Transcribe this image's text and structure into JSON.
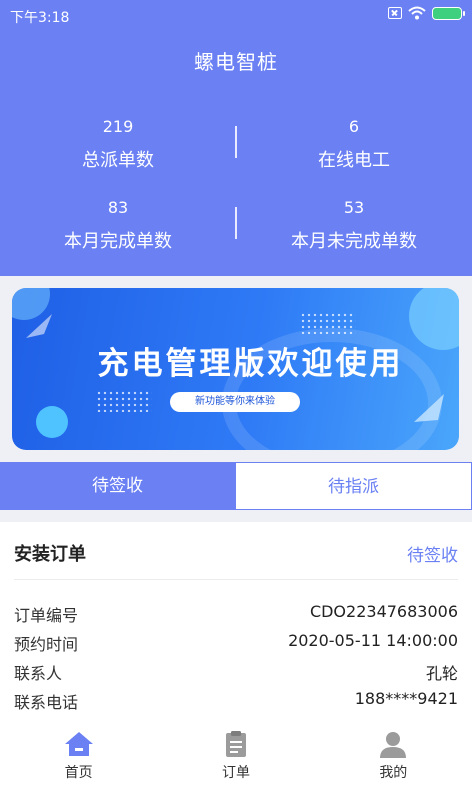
{
  "status_bar": {
    "time": "下午3:18"
  },
  "app_title": "螺电智桩",
  "stats": [
    {
      "value": "219",
      "label": "总派单数"
    },
    {
      "value": "6",
      "label": "在线电工"
    },
    {
      "value": "83",
      "label": "本月完成单数"
    },
    {
      "value": "53",
      "label": "本月未完成单数"
    }
  ],
  "banner": {
    "title": "充电管理版欢迎使用",
    "pill": "新功能等你来体验"
  },
  "tabs": [
    {
      "label": "待签收",
      "active": true
    },
    {
      "label": "待指派",
      "active": false
    }
  ],
  "order_card": {
    "title": "安装订单",
    "status": "待签收",
    "rows": [
      {
        "label": "订单编号",
        "value": "CDO22347683006"
      },
      {
        "label": "预约时间",
        "value": "2020-05-11 14:00:00"
      },
      {
        "label": "联系人",
        "value": "孔轮"
      },
      {
        "label": "联系电话",
        "value": "188****9421"
      }
    ]
  },
  "bottom_nav": [
    {
      "label": "首页",
      "icon": "home-icon",
      "active": true
    },
    {
      "label": "订单",
      "icon": "clipboard-icon",
      "active": false
    },
    {
      "label": "我的",
      "icon": "user-icon",
      "active": false
    }
  ],
  "colors": {
    "primary": "#6a80f3",
    "banner_blue": "#2f7bf6",
    "battery": "#3ed07f"
  }
}
